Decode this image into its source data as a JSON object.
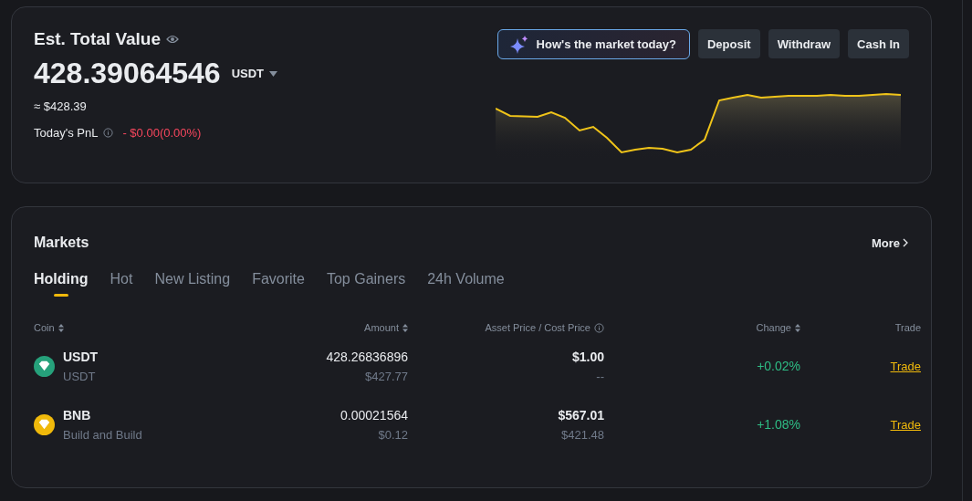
{
  "summary": {
    "title": "Est. Total Value",
    "value": "428.39064546",
    "currency": "USDT",
    "approx": "≈ $428.39",
    "pnl_label": "Today's PnL",
    "pnl_value": "- $0.00(0.00%)",
    "ai_button": "How's the market today?",
    "buttons": [
      "Deposit",
      "Withdraw",
      "Cash In"
    ]
  },
  "markets": {
    "title": "Markets",
    "more": "More",
    "tabs": [
      {
        "label": "Holding",
        "selected": true
      },
      {
        "label": "Hot",
        "selected": false
      },
      {
        "label": "New Listing",
        "selected": false
      },
      {
        "label": "Favorite",
        "selected": false
      },
      {
        "label": "Top Gainers",
        "selected": false
      },
      {
        "label": "24h Volume",
        "selected": false
      }
    ],
    "columns": [
      {
        "label": "Coin",
        "kind": "sort"
      },
      {
        "label": "Amount",
        "kind": "sort"
      },
      {
        "label": "Asset Price / Cost Price",
        "kind": "info"
      },
      {
        "label": "Change",
        "kind": "sort"
      },
      {
        "label": "Trade",
        "kind": "plain"
      }
    ],
    "rows": [
      {
        "symbol": "USDT",
        "name": "USDT",
        "color": "#26a17b",
        "amount": "428.26836896",
        "amount_usd": "$427.77",
        "price": "$1.00",
        "cost": "--",
        "change": "+0.02%",
        "trade": "Trade"
      },
      {
        "symbol": "BNB",
        "name": "Build and Build",
        "color": "#f0b90b",
        "amount": "0.00021564",
        "amount_usd": "$0.12",
        "price": "$567.01",
        "cost": "$421.48",
        "change": "+1.08%",
        "trade": "Trade"
      }
    ]
  }
}
